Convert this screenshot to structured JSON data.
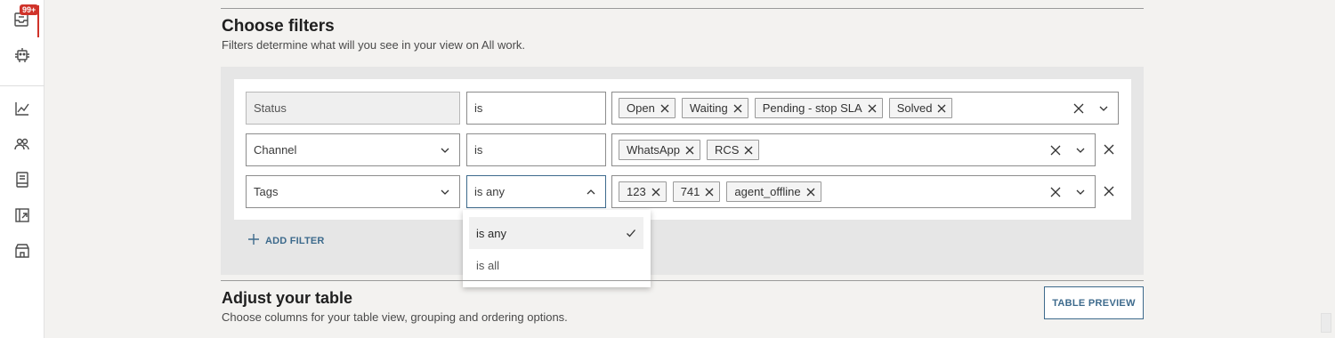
{
  "sidebar": {
    "badge": "99+",
    "items": [
      {
        "icon": "inbox-icon"
      },
      {
        "icon": "bot-icon"
      },
      {
        "icon": "analytics-icon"
      },
      {
        "icon": "contacts-icon"
      },
      {
        "icon": "knowledge-icon"
      },
      {
        "icon": "campaigns-icon"
      },
      {
        "icon": "store-icon"
      }
    ]
  },
  "filters_section": {
    "title": "Choose filters",
    "subtitle": "Filters determine what will you see in your view on All work."
  },
  "filters": [
    {
      "field": "Status",
      "operator": "is",
      "values": [
        "Open",
        "Waiting",
        "Pending - stop SLA",
        "Solved"
      ]
    },
    {
      "field": "Channel",
      "operator": "is",
      "values": [
        "WhatsApp",
        "RCS"
      ]
    },
    {
      "field": "Tags",
      "operator": "is any",
      "values": [
        "123",
        "741",
        "agent_offline"
      ]
    }
  ],
  "add_filter_label": "ADD FILTER",
  "operator_dropdown": {
    "options": [
      "is any",
      "is all"
    ],
    "selected": "is any"
  },
  "table_section": {
    "title": "Adjust your table",
    "subtitle": "Choose columns for your table view, grouping and ordering options.",
    "preview_button": "TABLE PREVIEW"
  },
  "colors": {
    "accent": "#3d6a8c",
    "badge": "#d0332a",
    "panel": "#e6e6e6",
    "background": "#f3f2f0"
  }
}
